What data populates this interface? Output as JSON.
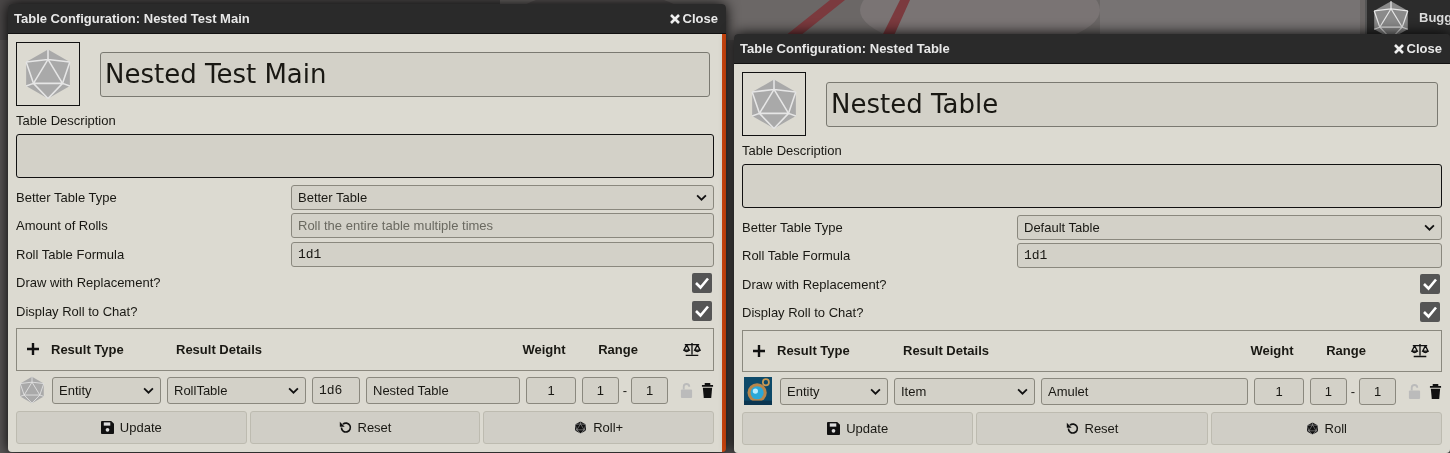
{
  "background_window": {
    "title": "Bugg"
  },
  "windows": [
    {
      "title": "Table Configuration: Nested Test Main",
      "close": "Close",
      "name": "Nested Test Main",
      "description_label": "Table Description",
      "scrollbar": true,
      "fields": [
        {
          "kind": "select",
          "label": "Better Table Type",
          "value": "Better Table"
        },
        {
          "kind": "input",
          "label": "Amount of Rolls",
          "placeholder": "Roll the entire table multiple times"
        },
        {
          "kind": "input",
          "label": "Roll Table Formula",
          "value": "1d1"
        },
        {
          "kind": "checkbox",
          "label": "Draw with Replacement?",
          "checked": true
        },
        {
          "kind": "checkbox",
          "label": "Display Roll to Chat?",
          "checked": true
        }
      ],
      "results_header": {
        "type": "Result Type",
        "details": "Result Details",
        "weight": "Weight",
        "range": "Range"
      },
      "results": [
        {
          "kind": "die",
          "type": "Entity",
          "collection": "RollTable",
          "formula": "1d6",
          "text": "Nested Table",
          "weight": "1",
          "range_low": "1",
          "range_separator": "-",
          "range_high": "1",
          "locked": false
        }
      ],
      "buttons": [
        {
          "kind": "update",
          "label": "Update"
        },
        {
          "kind": "reset",
          "label": "Reset"
        },
        {
          "kind": "roll",
          "label": "Roll+"
        }
      ]
    },
    {
      "title": "Table Configuration: Nested Table",
      "close": "Close",
      "name": "Nested Table",
      "description_label": "Table Description",
      "scrollbar": false,
      "fields": [
        {
          "kind": "select",
          "label": "Better Table Type",
          "value": "Default Table"
        },
        {
          "kind": "input",
          "label": "Roll Table Formula",
          "value": "1d1"
        },
        {
          "kind": "checkbox",
          "label": "Draw with Replacement?",
          "checked": true
        },
        {
          "kind": "checkbox",
          "label": "Display Roll to Chat?",
          "checked": true
        }
      ],
      "results_header": {
        "type": "Result Type",
        "details": "Result Details",
        "weight": "Weight",
        "range": "Range"
      },
      "results": [
        {
          "kind": "picture",
          "type": "Entity",
          "collection": "Item",
          "text": "Amulet",
          "weight": "1",
          "range_low": "1",
          "range_separator": "-",
          "range_high": "1",
          "locked": false
        }
      ],
      "buttons": [
        {
          "kind": "update",
          "label": "Update"
        },
        {
          "kind": "reset",
          "label": "Reset"
        },
        {
          "kind": "roll",
          "label": "Roll"
        }
      ]
    }
  ]
}
